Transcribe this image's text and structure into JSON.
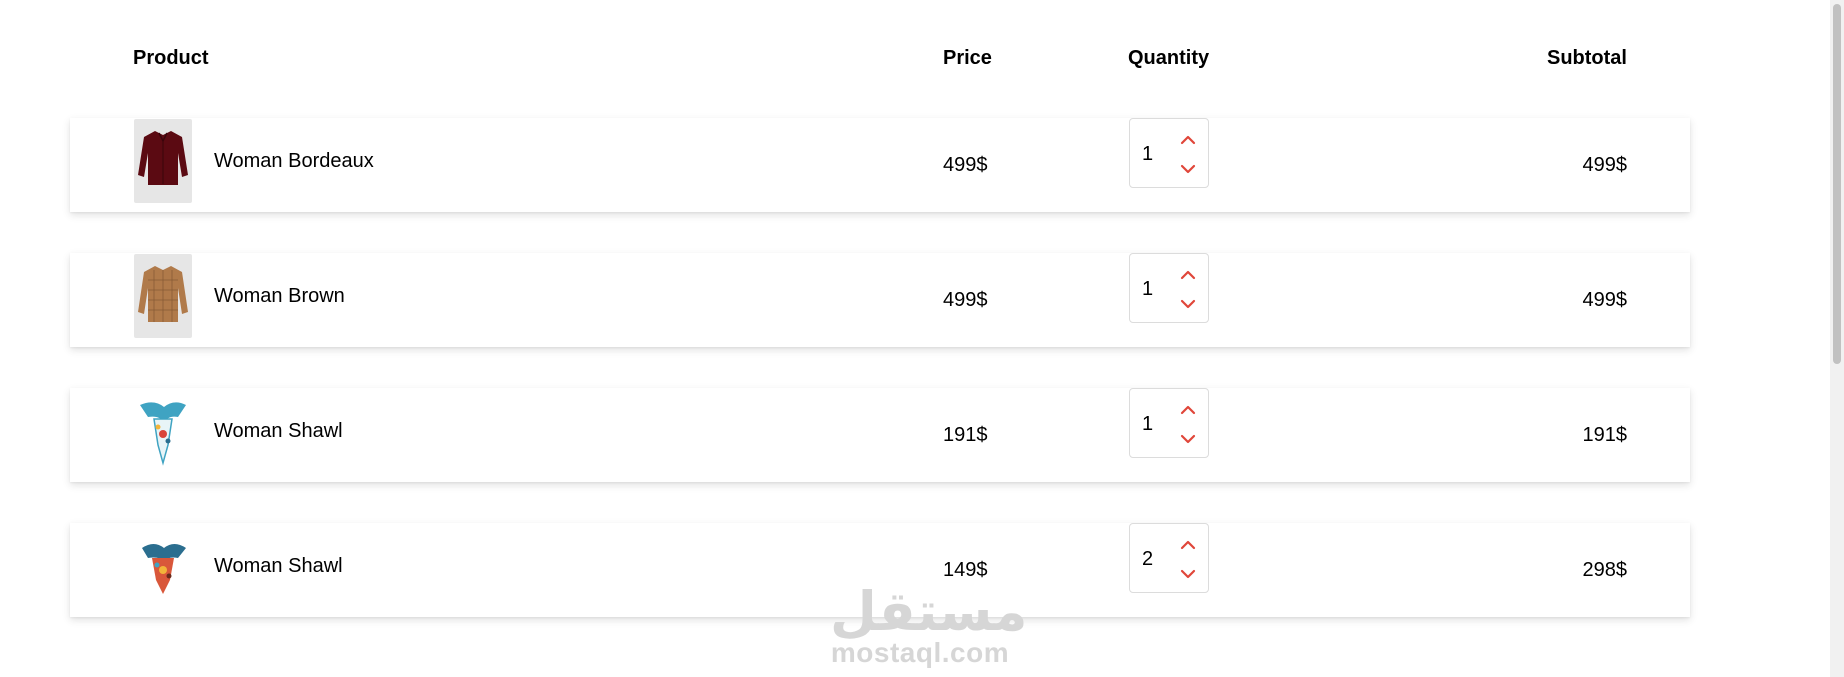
{
  "header": {
    "product": "Product",
    "price": "Price",
    "quantity": "Quantity",
    "subtotal": "Subtotal"
  },
  "items": [
    {
      "name": "Woman Bordeaux",
      "price": "499$",
      "quantity": "1",
      "subtotal": "499$",
      "image": "bordeaux-shirt"
    },
    {
      "name": "Woman Brown",
      "price": "499$",
      "quantity": "1",
      "subtotal": "499$",
      "image": "brown-plaid-shirt"
    },
    {
      "name": "Woman Shawl",
      "price": "191$",
      "quantity": "1",
      "subtotal": "191$",
      "image": "light-blue-shawl"
    },
    {
      "name": "Woman Shawl",
      "price": "149$",
      "quantity": "2",
      "subtotal": "298$",
      "image": "orange-shawl"
    }
  ],
  "icons": {
    "increment": "chevron-up-icon",
    "decrement": "chevron-down-icon"
  },
  "colors": {
    "stepper_accent": "#e0463a",
    "bordeaux": "#5b0a12",
    "brown": "#b07a4a"
  },
  "watermark": {
    "arabic": "مستقل",
    "latin": "mostaql.com"
  }
}
